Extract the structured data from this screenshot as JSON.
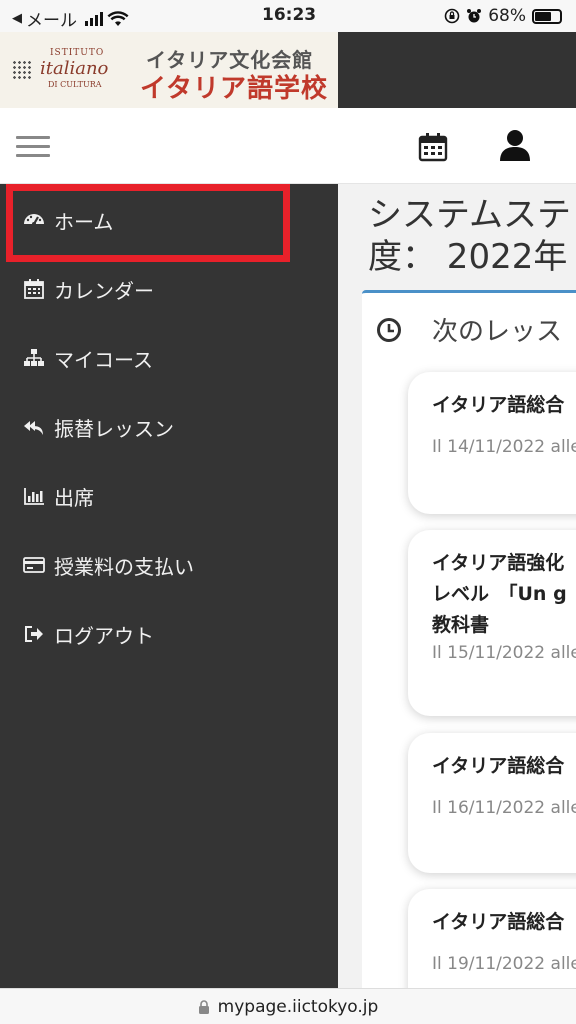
{
  "status_bar": {
    "back_arrow": "◀",
    "carrier": "メール",
    "time": "16:23",
    "battery": "68%",
    "battery_level": 0.68
  },
  "header": {
    "logo_latin_line1": "ISTITUTO",
    "logo_latin_line2": "italiano",
    "logo_latin_line3": "DI CULTURA",
    "logo_jp_line1": "イタリア文化会館",
    "logo_jp_line2": "イタリア語学校"
  },
  "toolbar": {
    "calendar_icon": "calendar-icon",
    "user_icon": "user-icon"
  },
  "sidebar": {
    "items": [
      {
        "label": "ホーム",
        "icon": "dashboard-icon"
      },
      {
        "label": "カレンダー",
        "icon": "calendar-icon"
      },
      {
        "label": "マイコース",
        "icon": "sitemap-icon"
      },
      {
        "label": "振替レッスン",
        "icon": "reply-all-icon"
      },
      {
        "label": "出席",
        "icon": "bar-chart-icon"
      },
      {
        "label": "授業料の支払い",
        "icon": "credit-card-icon"
      },
      {
        "label": "ログアウト",
        "icon": "sign-out-icon"
      }
    ],
    "highlight_color": "#e8212a"
  },
  "main": {
    "title_line1": "システムステ",
    "title_line2": "度： 2022年",
    "panel_title": "次のレッス",
    "lessons": [
      {
        "title": "イタリア語総合",
        "title_line2": "",
        "title_line3": "",
        "date": "Il 14/11/2022 alle"
      },
      {
        "title": "イタリア語強化",
        "title_line2": "レベル　「Un g",
        "title_line3": "教科書",
        "date": "Il 15/11/2022 alle"
      },
      {
        "title": "イタリア語総合",
        "title_line2": "",
        "title_line3": "",
        "date": "Il 16/11/2022 alle"
      },
      {
        "title": "イタリア語総合",
        "title_line2": "",
        "title_line3": "",
        "date": "Il 19/11/2022 alle"
      }
    ]
  },
  "url_bar": {
    "url": "mypage.iictokyo.jp"
  }
}
